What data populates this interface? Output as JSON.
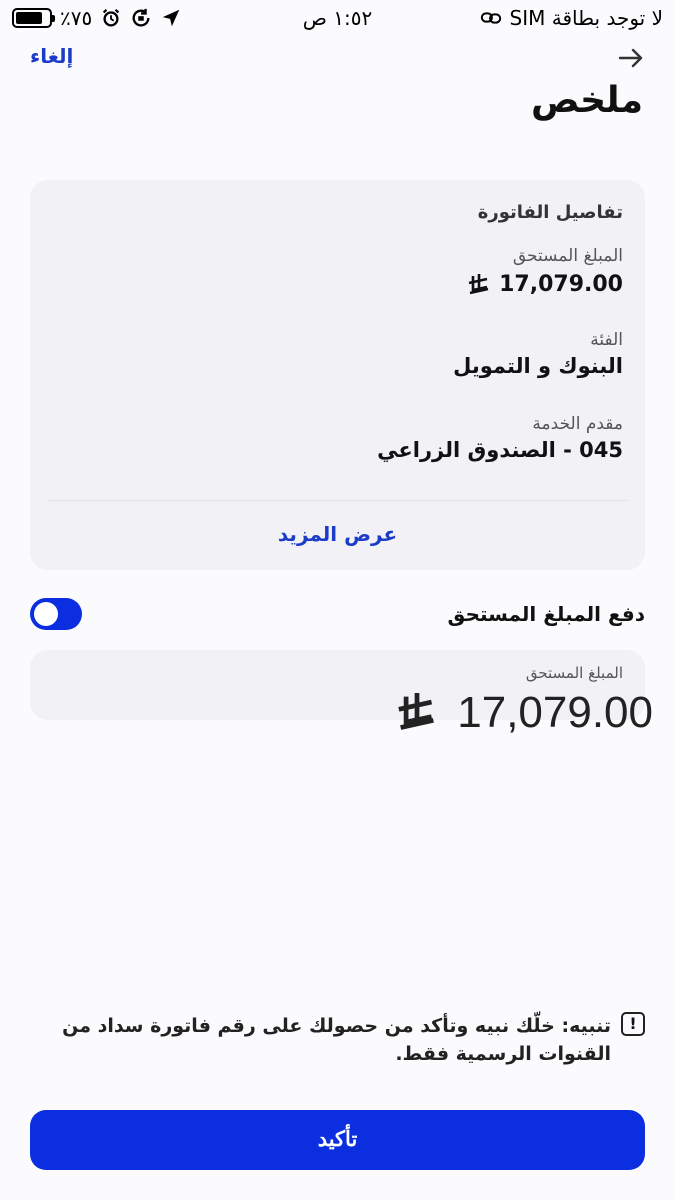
{
  "status_bar": {
    "battery_percent": "٪٧٥",
    "battery_level": 0.75,
    "time": "١:٥٢ ص",
    "carrier": "لا توجد بطاقة SIM"
  },
  "nav": {
    "cancel_label": "إلغاء",
    "title": "ملخص"
  },
  "bill_details": {
    "heading": "تفاصيل الفاتورة",
    "amount_due_label": "المبلغ المستحق",
    "amount_due_value": "17,079.00",
    "currency_symbol": "⃁",
    "category_label": "الفئة",
    "category_value": "البنوك و التمويل",
    "provider_label": "مقدم الخدمة",
    "provider_value": "045 - الصندوق الزراعي",
    "show_more_label": "عرض المزيد"
  },
  "pay_due": {
    "toggle_label": "دفع المبلغ المستحق",
    "toggle_on": true,
    "amount_label": "المبلغ المستحق",
    "amount_value": "17,079.00"
  },
  "notice": {
    "text": "تنبيه: خلّك نبيه وتأكد من حصولك على رقم فاتورة سداد من القنوات الرسمية فقط."
  },
  "confirm_label": "تأكيد",
  "colors": {
    "accent": "#0b2fe0",
    "link": "#1a3cc8",
    "card_bg": "#f2f2f6",
    "page_bg": "#fbfbfd"
  }
}
